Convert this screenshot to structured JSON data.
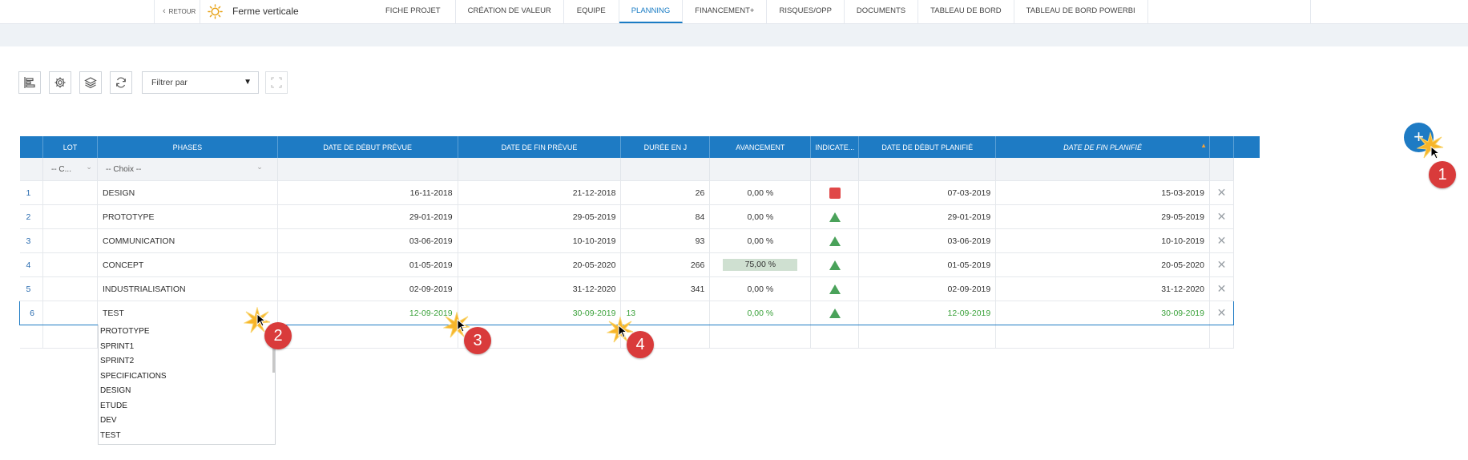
{
  "topbar": {
    "back_label": "RETOUR",
    "project_title": "Ferme verticale",
    "tabs": [
      "FICHE PROJET",
      "CRÉATION DE VALEUR",
      "EQUIPE",
      "PLANNING",
      "FINANCEMENT+",
      "RISQUES/OPP",
      "DOCUMENTS",
      "TABLEAU DE BORD",
      "TABLEAU DE BORD POWERBI"
    ],
    "active_tab": "PLANNING"
  },
  "toolbar": {
    "filter_label": "Filtrer par"
  },
  "table": {
    "columns": [
      "",
      "LOT",
      "PHASES",
      "DATE DE DÉBUT PRÉVUE",
      "DATE DE FIN PRÉVUE",
      "DURÉE EN J",
      "AVANCEMENT",
      "INDICATE...",
      "DATE DE DÉBUT PLANIFIÉ",
      "DATE DE FIN PLANIFIÉ",
      ""
    ],
    "filter_lot": "-- C...",
    "filter_phase": "-- Choix --",
    "rows": [
      {
        "idx": "1",
        "phase": "DESIGN",
        "start": "16-11-2018",
        "end": "21-12-2018",
        "duration": "26",
        "progress": "0,00 %",
        "indicator": "red-square",
        "plan_start": "07-03-2019",
        "plan_end": "15-03-2019"
      },
      {
        "idx": "2",
        "phase": "PROTOTYPE",
        "start": "29-01-2019",
        "end": "29-05-2019",
        "duration": "84",
        "progress": "0,00 %",
        "indicator": "green-triangle",
        "plan_start": "29-01-2019",
        "plan_end": "29-05-2019"
      },
      {
        "idx": "3",
        "phase": "COMMUNICATION",
        "start": "03-06-2019",
        "end": "10-10-2019",
        "duration": "93",
        "progress": "0,00 %",
        "indicator": "green-triangle",
        "plan_start": "03-06-2019",
        "plan_end": "10-10-2019"
      },
      {
        "idx": "4",
        "phase": "CONCEPT",
        "start": "01-05-2019",
        "end": "20-05-2020",
        "duration": "266",
        "progress": "75,00 %",
        "progress_fraction": 0.75,
        "indicator": "green-triangle",
        "plan_start": "01-05-2019",
        "plan_end": "20-05-2020"
      },
      {
        "idx": "5",
        "phase": "INDUSTRIALISATION",
        "start": "02-09-2019",
        "end": "31-12-2020",
        "duration": "341",
        "progress": "0,00 %",
        "indicator": "green-triangle",
        "plan_start": "02-09-2019",
        "plan_end": "31-12-2020"
      }
    ],
    "edit_row": {
      "idx": "6",
      "phase": "TEST",
      "start": "12-09-2019",
      "end": "30-09-2019",
      "duration": "13",
      "progress": "0,00 %",
      "indicator": "green-triangle",
      "plan_start": "12-09-2019",
      "plan_end": "30-09-2019"
    }
  },
  "dropdown": {
    "options": [
      "PROTOTYPE",
      "SPRINT1",
      "SPRINT2",
      "SPECIFICATIONS",
      "DESIGN",
      "ETUDE",
      "DEV",
      "TEST"
    ]
  },
  "annotations": [
    "1",
    "2",
    "3",
    "4"
  ],
  "colors": {
    "header_blue": "#1e7bc4",
    "status_red": "#e04848",
    "status_green": "#4aa25a",
    "edit_green": "#3aa13a",
    "badge_red": "#d93b3b"
  },
  "icons": [
    "chevron-left-icon",
    "sun-icon",
    "gantt-icon",
    "gear-icon",
    "layers-icon",
    "refresh-icon",
    "fullscreen-icon",
    "plus-icon",
    "delete-icon",
    "sort-arrow-icon"
  ]
}
